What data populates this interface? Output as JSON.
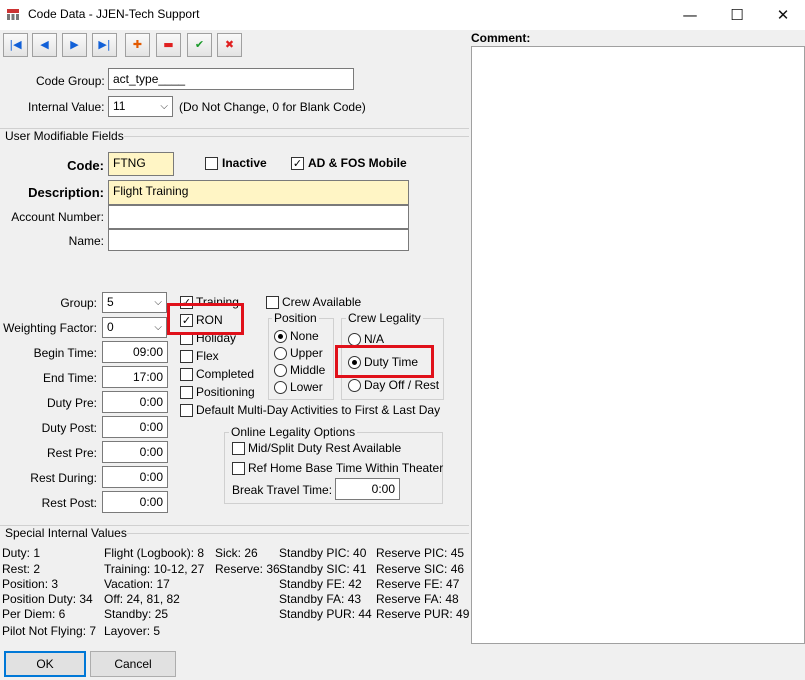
{
  "window": {
    "title": "Code Data - JJEN-Tech Support",
    "minimize_glyph": "—",
    "maximize_glyph": "☐",
    "close_glyph": "✕"
  },
  "toolbar": {
    "first": "|◀",
    "prev": "◀",
    "next": "▶",
    "last": "▶|",
    "add": "✚",
    "delete": "▬",
    "save": "✔",
    "cancel": "✖"
  },
  "header": {
    "code_group_label": "Code Group:",
    "code_group_value": "act_type____",
    "internal_value_label": "Internal Value:",
    "internal_value": "11",
    "internal_value_hint": "(Do Not Change, 0 for Blank Code)"
  },
  "comment": {
    "label": "Comment:",
    "value": ""
  },
  "user_fields": {
    "section_title": "User Modifiable Fields",
    "code_label": "Code:",
    "code_value": "FTNG",
    "inactive_label": "Inactive",
    "inactive_checked": false,
    "ad_fos_label": "AD & FOS Mobile",
    "ad_fos_checked": true,
    "description_label": "Description:",
    "description_value": "Flight Training",
    "account_number_label": "Account Number:",
    "account_number_value": "",
    "name_label": "Name:",
    "name_value": ""
  },
  "settings": {
    "group_label": "Group:",
    "group_value": "5",
    "weighting_label": "Weighting Factor:",
    "weighting_value": "0",
    "begin_time_label": "Begin Time:",
    "begin_time": "09:00",
    "end_time_label": "End Time:",
    "end_time": "17:00",
    "duty_pre_label": "Duty Pre:",
    "duty_pre": "0:00",
    "duty_post_label": "Duty Post:",
    "duty_post": "0:00",
    "rest_pre_label": "Rest Pre:",
    "rest_pre": "0:00",
    "rest_during_label": "Rest During:",
    "rest_during": "0:00",
    "rest_post_label": "Rest Post:",
    "rest_post": "0:00"
  },
  "flags": {
    "training": "Training",
    "ron": "RON",
    "holiday": "Holiday",
    "flex": "Flex",
    "completed": "Completed",
    "positioning": "Positioning",
    "default_multi_day": "Default Multi-Day Activities to First & Last Day",
    "crew_available": "Crew Available",
    "check": "✓"
  },
  "position": {
    "title": "Position",
    "options": [
      "None",
      "Upper",
      "Middle",
      "Lower"
    ],
    "selected": "None"
  },
  "crew_legality": {
    "title": "Crew Legality",
    "options": [
      "N/A",
      "Duty Time",
      "Day Off / Rest"
    ],
    "selected": "Duty Time"
  },
  "online_legality": {
    "title": "Online Legality Options",
    "mid_split": "Mid/Split Duty Rest Available",
    "ref_home": "Ref Home Base Time Within Theater",
    "break_travel_label": "Break Travel Time:",
    "break_travel_value": "0:00"
  },
  "special": {
    "title": "Special Internal Values",
    "col1": [
      "Duty: 1",
      "Rest: 2",
      "Position: 3",
      "Position Duty: 34",
      "Per Diem: 6",
      "Pilot Not Flying: 7"
    ],
    "col2": [
      "Flight (Logbook): 8",
      "Training: 10-12, 27",
      "Vacation: 17",
      "Off: 24, 81, 82",
      "Standby: 25",
      "Layover: 5"
    ],
    "col3": [
      "Sick: 26",
      "Reserve: 36"
    ],
    "col4": [
      "Standby PIC: 40",
      "Standby SIC: 41",
      "Standby FE: 42",
      "Standby FA: 43",
      "Standby PUR: 44"
    ],
    "col5": [
      "Reserve PIC: 45",
      "Reserve SIC: 46",
      "Reserve FE: 47",
      "Reserve FA: 48",
      "Reserve PUR: 49"
    ]
  },
  "buttons": {
    "ok": "OK",
    "cancel": "Cancel"
  },
  "colors": {
    "highlight": "#e0101a",
    "required_field": "#fff5c5"
  }
}
